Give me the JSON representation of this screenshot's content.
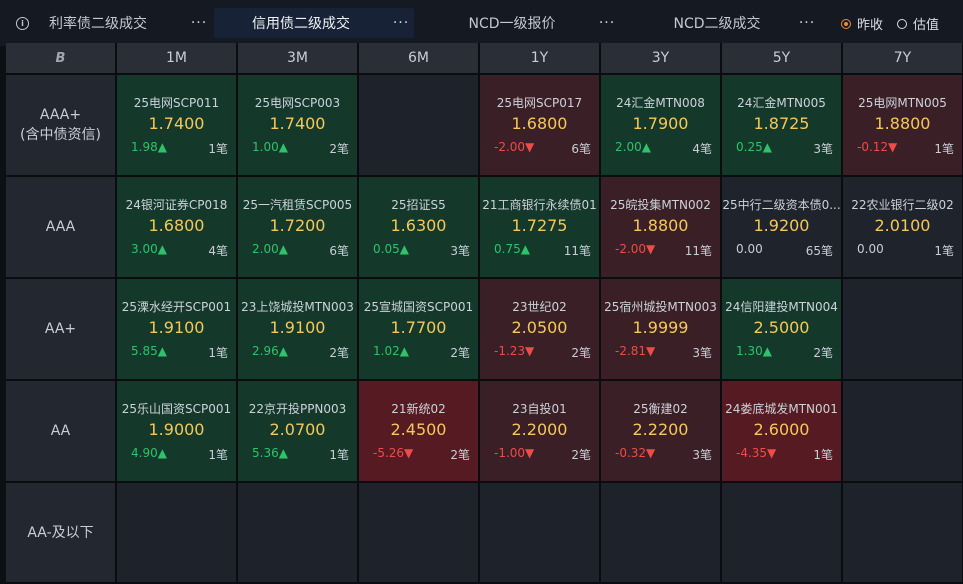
{
  "tabs": [
    {
      "label": "利率债二级成交",
      "dots": "···"
    },
    {
      "label": "信用债二级成交",
      "dots": "···"
    },
    {
      "label": "NCD一级报价",
      "dots": "···"
    },
    {
      "label": "NCD二级成交",
      "dots": "···"
    }
  ],
  "info_icon": "i",
  "radio": [
    {
      "label": "昨收",
      "selected": true
    },
    {
      "label": "估值",
      "selected": false
    }
  ],
  "corner_icon": "B",
  "columns": [
    "1M",
    "3M",
    "6M",
    "1Y",
    "3Y",
    "5Y",
    "7Y"
  ],
  "rows": [
    {
      "label": "AAA+",
      "sublabel": "(含中债资信)",
      "cells": [
        {
          "name": "25电网SCP011",
          "price": "1.7400",
          "chg": "1.98▲",
          "dir": "up",
          "count": "1笔",
          "bg": "green"
        },
        {
          "name": "25电网SCP003",
          "price": "1.7400",
          "chg": "1.00▲",
          "dir": "up",
          "count": "2笔",
          "bg": "green"
        },
        null,
        {
          "name": "25电网SCP017",
          "price": "1.6800",
          "chg": "-2.00▼",
          "dir": "down",
          "count": "6笔",
          "bg": "red"
        },
        {
          "name": "24汇金MTN008",
          "price": "1.7900",
          "chg": "2.00▲",
          "dir": "up",
          "count": "4笔",
          "bg": "green"
        },
        {
          "name": "24汇金MTN005",
          "price": "1.8725",
          "chg": "0.25▲",
          "dir": "up",
          "count": "3笔",
          "bg": "green"
        },
        {
          "name": "25电网MTN005",
          "price": "1.8800",
          "chg": "-0.12▼",
          "dir": "down",
          "count": "1笔",
          "bg": "red"
        }
      ]
    },
    {
      "label": "AAA",
      "sublabel": "",
      "cells": [
        {
          "name": "24银河证券CP018",
          "price": "1.6800",
          "chg": "3.00▲",
          "dir": "up",
          "count": "4笔",
          "bg": "green"
        },
        {
          "name": "25一汽租赁SCP005",
          "price": "1.7200",
          "chg": "2.00▲",
          "dir": "up",
          "count": "6笔",
          "bg": "green"
        },
        {
          "name": "25招证S5",
          "price": "1.6300",
          "chg": "0.05▲",
          "dir": "up",
          "count": "3笔",
          "bg": "green"
        },
        {
          "name": "21工商银行永续债01",
          "price": "1.7275",
          "chg": "0.75▲",
          "dir": "up",
          "count": "11笔",
          "bg": "green"
        },
        {
          "name": "25皖投集MTN002",
          "price": "1.8800",
          "chg": "-2.00▼",
          "dir": "down",
          "count": "11笔",
          "bg": "red"
        },
        {
          "name": "25中行二级资本债0...",
          "price": "1.9200",
          "chg": "0.00",
          "dir": "flat",
          "count": "65笔",
          "bg": "dark"
        },
        {
          "name": "22农业银行二级02",
          "price": "2.0100",
          "chg": "0.00",
          "dir": "flat",
          "count": "1笔",
          "bg": "dark"
        }
      ]
    },
    {
      "label": "AA+",
      "sublabel": "",
      "cells": [
        {
          "name": "25溧水经开SCP001",
          "price": "1.9100",
          "chg": "5.85▲",
          "dir": "up",
          "count": "1笔",
          "bg": "green"
        },
        {
          "name": "23上饶城投MTN003",
          "price": "1.9100",
          "chg": "2.96▲",
          "dir": "up",
          "count": "2笔",
          "bg": "green"
        },
        {
          "name": "25宣城国资SCP001",
          "price": "1.7700",
          "chg": "1.02▲",
          "dir": "up",
          "count": "2笔",
          "bg": "green"
        },
        {
          "name": "23世纪02",
          "price": "2.0500",
          "chg": "-1.23▼",
          "dir": "down",
          "count": "2笔",
          "bg": "red"
        },
        {
          "name": "25宿州城投MTN003",
          "price": "1.9999",
          "chg": "-2.81▼",
          "dir": "down",
          "count": "3笔",
          "bg": "red"
        },
        {
          "name": "24信阳建投MTN004",
          "price": "2.5000",
          "chg": "1.30▲",
          "dir": "up",
          "count": "2笔",
          "bg": "green"
        },
        null
      ]
    },
    {
      "label": "AA",
      "sublabel": "",
      "cells": [
        {
          "name": "25乐山国资SCP001",
          "price": "1.9000",
          "chg": "4.90▲",
          "dir": "up",
          "count": "1笔",
          "bg": "green"
        },
        {
          "name": "22京开投PPN003",
          "price": "2.0700",
          "chg": "5.36▲",
          "dir": "up",
          "count": "1笔",
          "bg": "green"
        },
        {
          "name": "21新统02",
          "price": "2.4500",
          "chg": "-5.26▼",
          "dir": "down",
          "count": "2笔",
          "bg": "bright-red"
        },
        {
          "name": "23自投01",
          "price": "2.2000",
          "chg": "-1.00▼",
          "dir": "down",
          "count": "2笔",
          "bg": "red"
        },
        {
          "name": "25衡建02",
          "price": "2.2200",
          "chg": "-0.32▼",
          "dir": "down",
          "count": "3笔",
          "bg": "red"
        },
        {
          "name": "24娄底城发MTN001",
          "price": "2.6000",
          "chg": "-4.35▼",
          "dir": "down",
          "count": "1笔",
          "bg": "bright-red"
        },
        null
      ]
    },
    {
      "label": "AA-及以下",
      "sublabel": "",
      "cells": [
        null,
        null,
        null,
        null,
        null,
        null,
        null
      ]
    }
  ],
  "colors": {
    "up": "#2fc26a",
    "down": "#ee4b4b",
    "price": "#f4c85a",
    "accent": "#e98b3b"
  }
}
